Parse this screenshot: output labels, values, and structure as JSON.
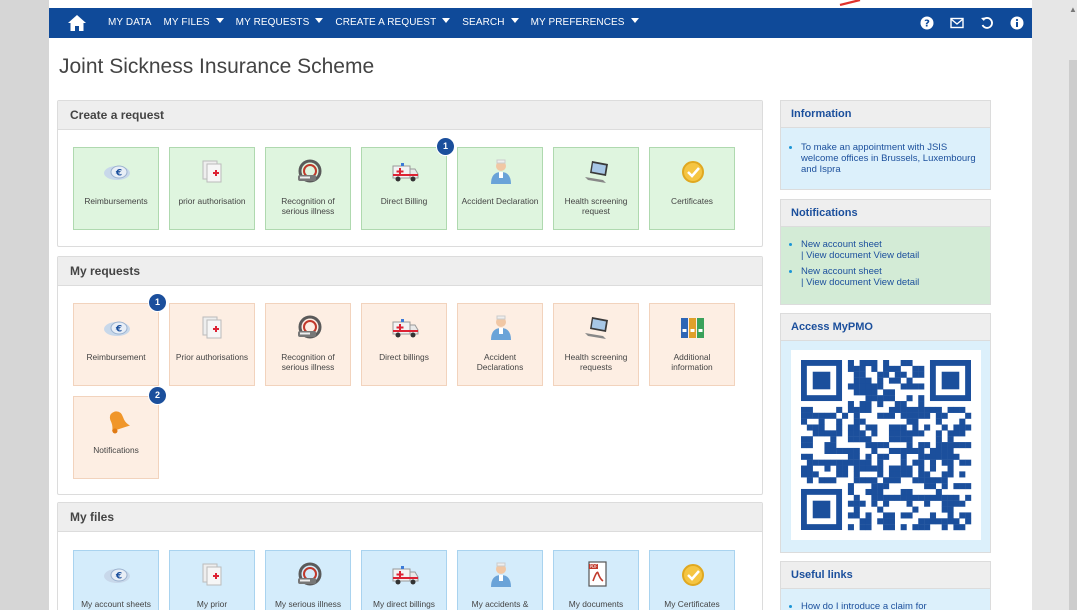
{
  "nav": {
    "items": [
      {
        "label": "MY DATA",
        "caret": false
      },
      {
        "label": "MY FILES",
        "caret": true
      },
      {
        "label": "MY REQUESTS",
        "caret": true
      },
      {
        "label": "CREATE A REQUEST",
        "caret": true
      },
      {
        "label": "SEARCH",
        "caret": true
      },
      {
        "label": "MY PREFERENCES",
        "caret": true
      }
    ]
  },
  "page": {
    "title": "Joint Sickness Insurance Scheme"
  },
  "colors": {
    "nav": "#0f4a99",
    "badge": "#1b4f9c",
    "create_tile": "#dff5df",
    "request_tile": "#fdeee3",
    "file_tile": "#d4ecfb"
  },
  "create": {
    "header": "Create a request",
    "tiles": [
      {
        "label": "Reimbursements",
        "icon": "euro-coin-icon"
      },
      {
        "label": "prior authorisation",
        "icon": "medical-documents-icon"
      },
      {
        "label": "Recognition of serious illness",
        "icon": "scanner-icon"
      },
      {
        "label": "Direct Billing",
        "icon": "ambulance-icon",
        "badge": "1"
      },
      {
        "label": "Accident Declaration",
        "icon": "nurse-icon"
      },
      {
        "label": "Health screening request",
        "icon": "laptop-icon"
      },
      {
        "label": "Certificates",
        "icon": "certificate-seal-icon"
      }
    ]
  },
  "requests": {
    "header": "My requests",
    "tiles": [
      {
        "label": "Reimbursement",
        "icon": "euro-coin-icon",
        "badge": "1"
      },
      {
        "label": "Prior authorisations",
        "icon": "medical-documents-icon"
      },
      {
        "label": "Recognition of serious illness",
        "icon": "scanner-icon"
      },
      {
        "label": "Direct billings",
        "icon": "ambulance-icon"
      },
      {
        "label": "Accident Declarations",
        "icon": "nurse-icon"
      },
      {
        "label": "Health screening requests",
        "icon": "laptop-icon"
      },
      {
        "label": "Additional information",
        "icon": "binders-icon"
      },
      {
        "label": "Notifications",
        "icon": "bell-icon",
        "badge": "2"
      }
    ]
  },
  "files": {
    "header": "My files",
    "tiles": [
      {
        "label": "My account sheets",
        "icon": "euro-coin-icon"
      },
      {
        "label": "My prior",
        "icon": "medical-documents-icon"
      },
      {
        "label": "My serious illness",
        "icon": "scanner-icon"
      },
      {
        "label": "My direct billings",
        "icon": "ambulance-icon"
      },
      {
        "label": "My accidents &",
        "icon": "nurse-icon"
      },
      {
        "label": "My documents",
        "icon": "pdf-document-icon"
      },
      {
        "label": "My Certificates",
        "icon": "certificate-seal-icon"
      }
    ]
  },
  "sidebar": {
    "information": {
      "header": "Information",
      "text": "To make an appointment with JSIS welcome offices in Brussels, Luxembourg and Ispra"
    },
    "notifications": {
      "header": "Notifications",
      "items": [
        {
          "title": "New account sheet",
          "links": "| View document View detail"
        },
        {
          "title": "New account sheet",
          "links": "| View document View detail"
        }
      ]
    },
    "mypmo": {
      "header": "Access MyPMO"
    },
    "useful": {
      "header": "Useful links",
      "first_item": "How do I introduce a claim for"
    }
  }
}
